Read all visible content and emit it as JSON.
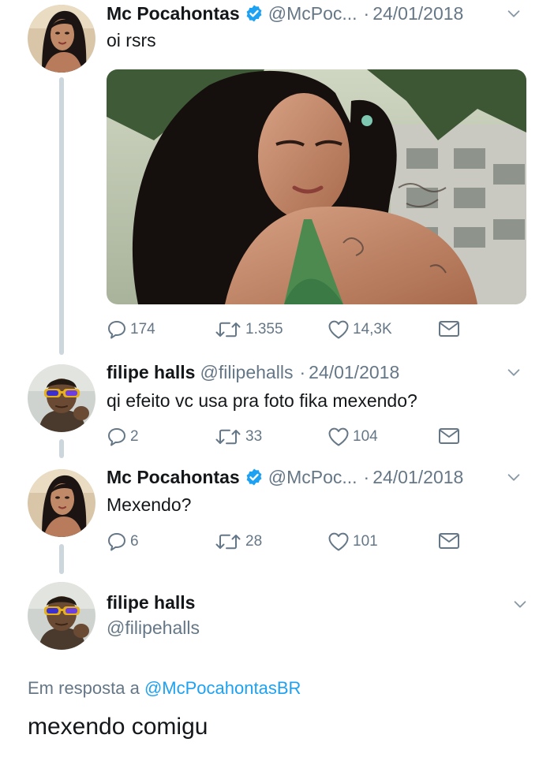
{
  "tweets": [
    {
      "name": "Mc Pocahontas",
      "handle": "@McPoc...",
      "separator": "·",
      "date": "24/01/2018",
      "text": "oi rsrs",
      "replies": "174",
      "retweets": "1.355",
      "likes": "14,3K",
      "verified": true
    },
    {
      "name": "filipe halls",
      "handle": "@filipehalls",
      "separator": "·",
      "date": "24/01/2018",
      "text": "qi efeito vc usa pra foto fika mexendo?",
      "replies": "2",
      "retweets": "33",
      "likes": "104",
      "verified": false
    },
    {
      "name": "Mc Pocahontas",
      "handle": "@McPoc...",
      "separator": "·",
      "date": "24/01/2018",
      "text": "Mexendo?",
      "replies": "6",
      "retweets": "28",
      "likes": "101",
      "verified": true
    }
  ],
  "main_tweet": {
    "name": "filipe halls",
    "handle": "@filipehalls",
    "reply_prefix": "Em resposta a",
    "reply_mention": "@McPocahontasBR",
    "text": "mexendo comigu"
  },
  "icons": {
    "verified": "verified-badge-icon",
    "reply": "reply-icon",
    "retweet": "retweet-icon",
    "like": "heart-icon",
    "dm": "envelope-icon",
    "chevron": "chevron-down-icon"
  },
  "colors": {
    "text": "#14171a",
    "secondary": "#657786",
    "accent": "#1da1f2",
    "thread_line": "#ccd6dd"
  }
}
